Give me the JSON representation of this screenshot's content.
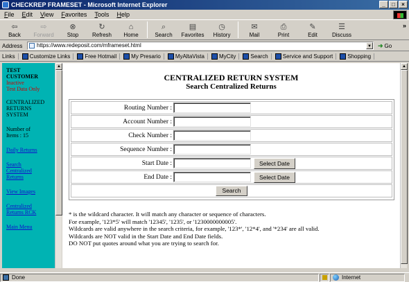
{
  "window": {
    "title": "CHECKREP FRAMESET - Microsoft Internet Explorer"
  },
  "menu": [
    "File",
    "Edit",
    "View",
    "Favorites",
    "Tools",
    "Help"
  ],
  "toolbar": {
    "back": "Back",
    "forward": "Forward",
    "stop": "Stop",
    "refresh": "Refresh",
    "home": "Home",
    "search": "Search",
    "favorites": "Favorites",
    "history": "History",
    "mail": "Mail",
    "print": "Print",
    "edit": "Edit",
    "discuss": "Discuss"
  },
  "address": {
    "label": "Address",
    "url": "https://www.redeposit.com/mframeset.html",
    "go": "Go"
  },
  "links": {
    "label": "Links",
    "items": [
      "Customize Links",
      "Free Hotmail",
      "My Presario",
      "MyAltaVista",
      "MyCity",
      "Search",
      "Service and Support",
      "Shopping"
    ]
  },
  "sidebar": {
    "customer_line1": "TEST",
    "customer_line2": "CUSTOMER",
    "inactive_line1": "Inactive",
    "inactive_line2": "Test Data Only",
    "system_line1": "CENTRALIZED",
    "system_line2": "RETURNS",
    "system_line3": "SYSTEM",
    "items_label": "Number of",
    "items_count": "Items : 15",
    "links": [
      "Daily Returns",
      "Search",
      "Centralized",
      "Returns",
      "View Images",
      "Centralized",
      "Returns RCK",
      "Main Menu"
    ]
  },
  "main": {
    "title": "CENTRALIZED RETURN SYSTEM",
    "subtitle": "Search Centralized Returns",
    "fields": {
      "routing": "Routing Number :",
      "account": "Account Number :",
      "check": "Check Number :",
      "sequence": "Sequence Number :",
      "start_date": "Start Date :",
      "end_date": "End Date :"
    },
    "select_date": "Select Date",
    "search": "Search",
    "notes": [
      "* is the wildcard character. It will match any character or sequence of characters.",
      "For example, '123*5' will match '12345', '1235', or '1230000000005'.",
      "Wildcards are valid anywhere in the search criteria, for example, '123*', '12*4', and '*234' are all valid.",
      "Wildcards are NOT valid in the Start Date and End Date fields.",
      "DO NOT put quotes around what you are trying to search for."
    ]
  },
  "status": {
    "text": "Done",
    "zone": "Internet"
  }
}
